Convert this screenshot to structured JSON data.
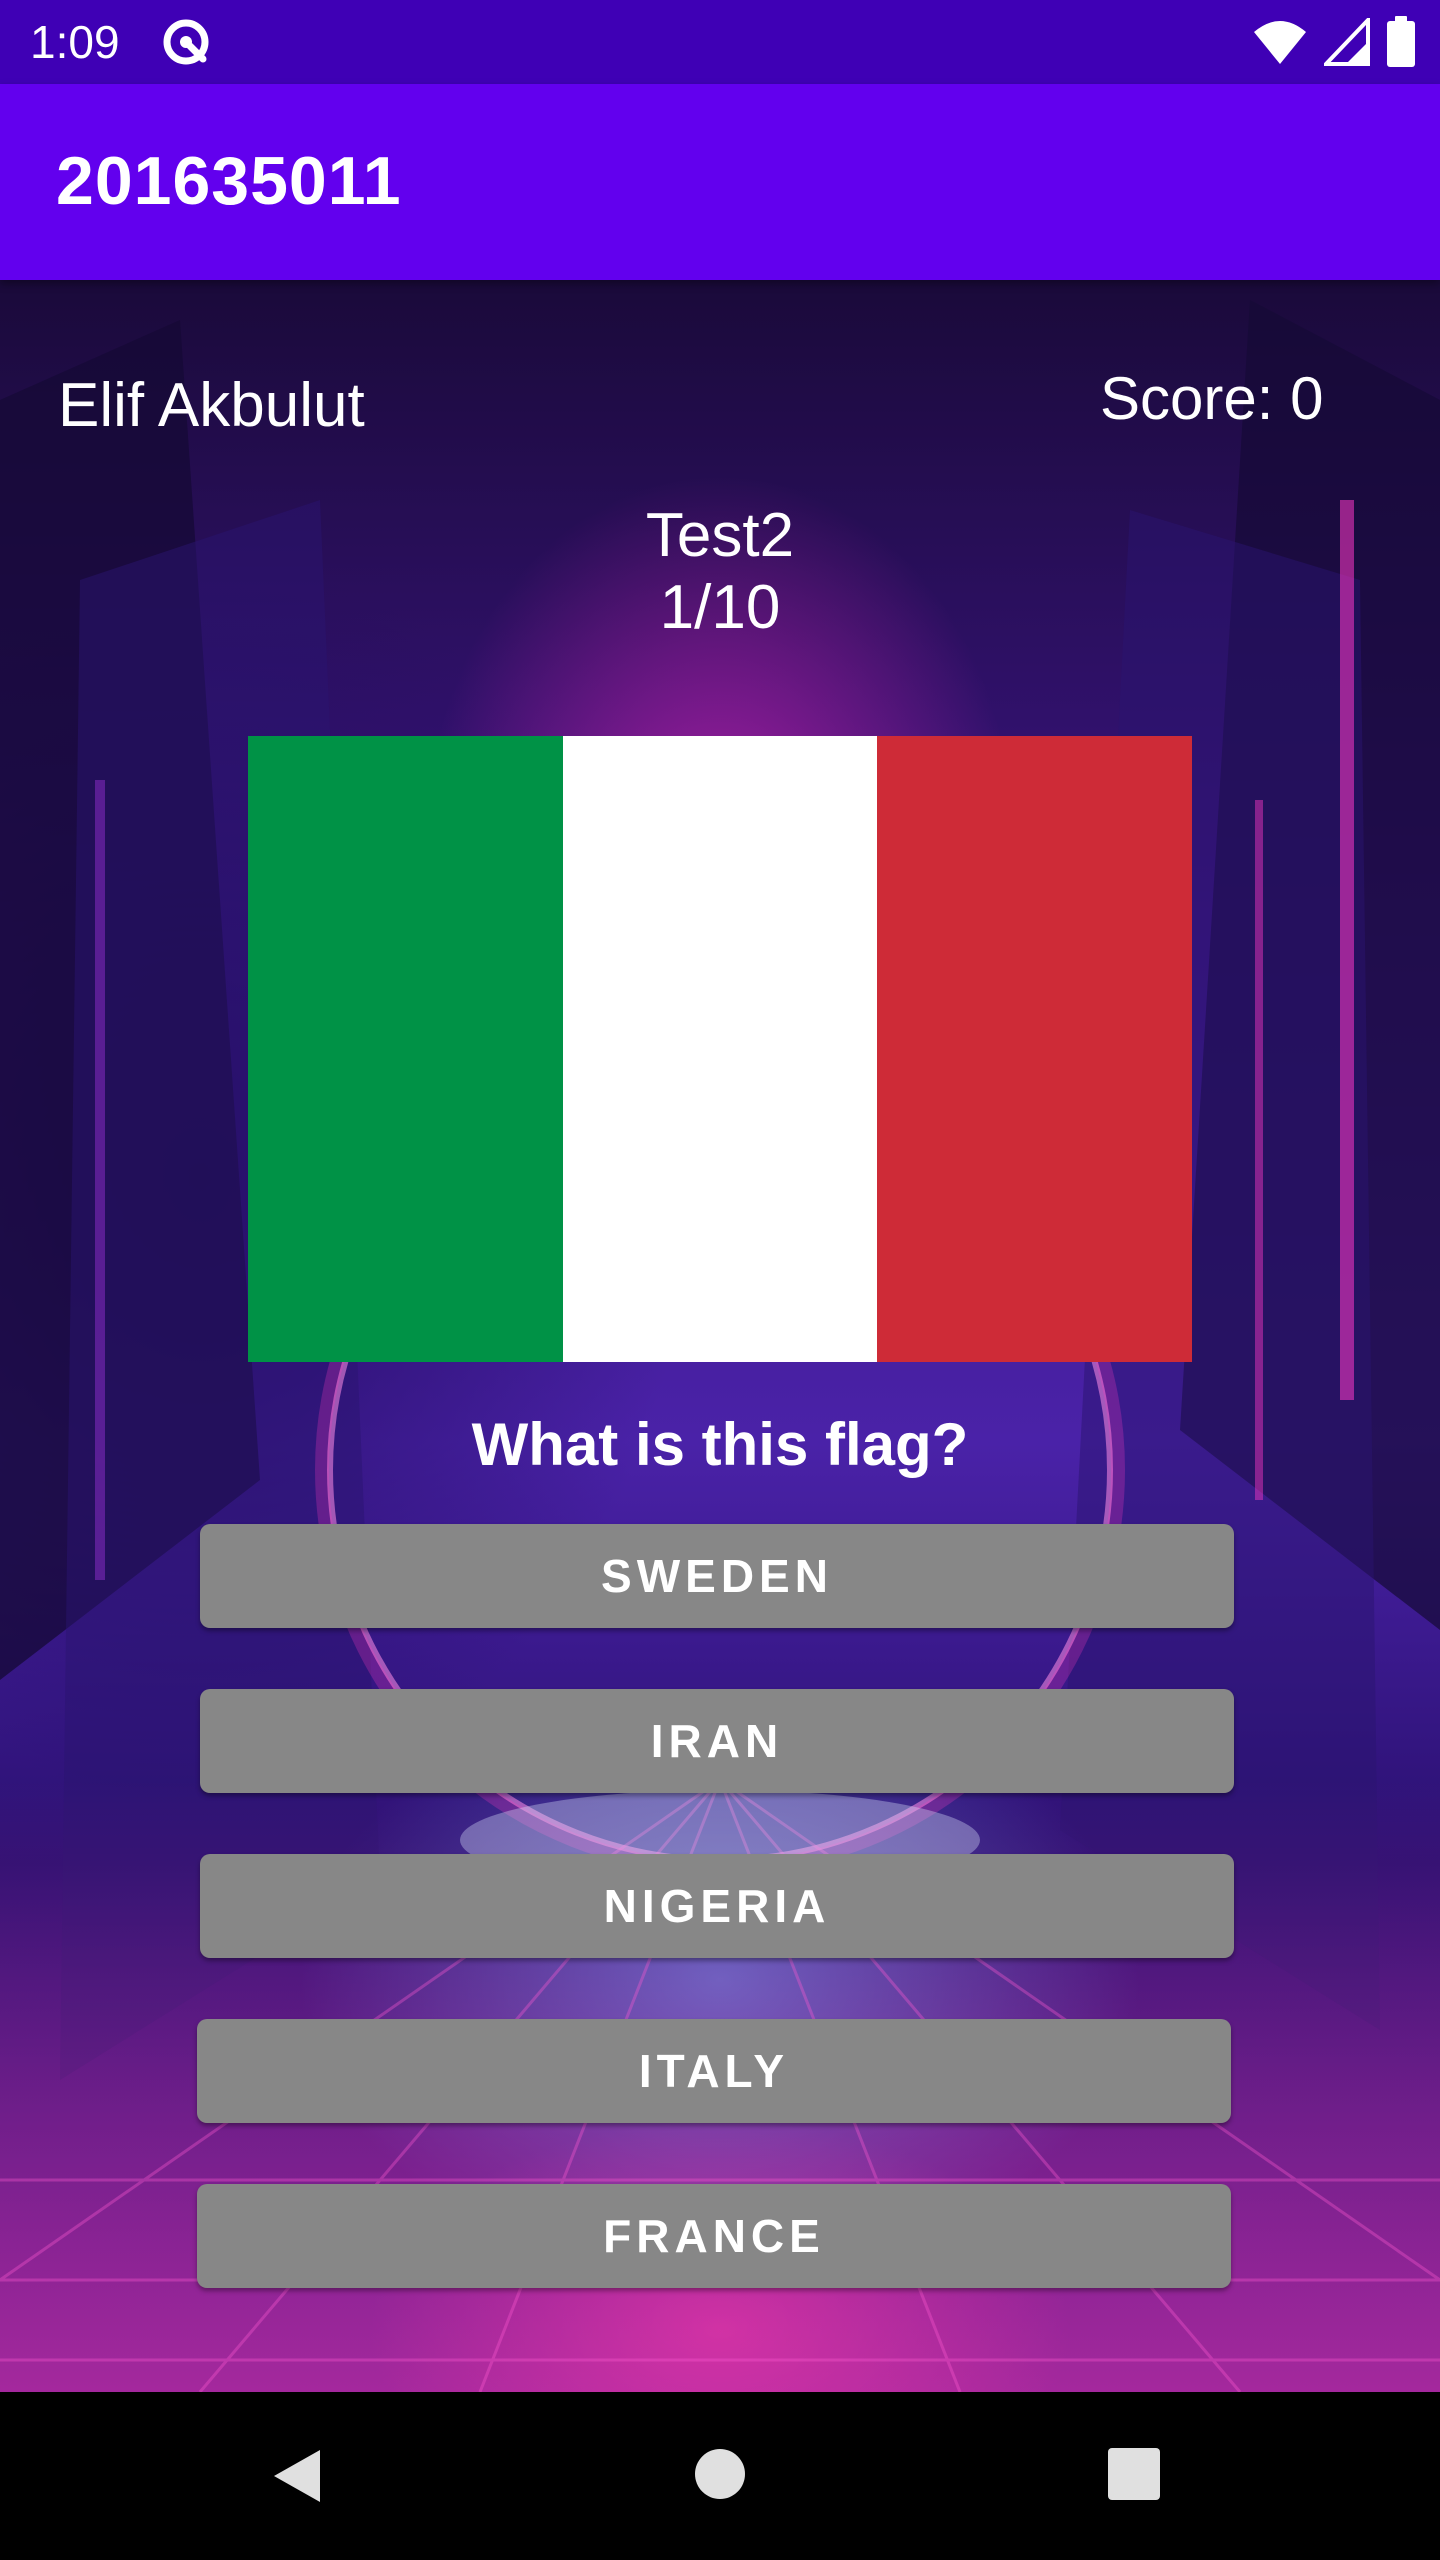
{
  "status_bar": {
    "time": "1:09",
    "icons": [
      "notification-icon",
      "wifi-icon",
      "cellular-signal-icon",
      "battery-icon"
    ]
  },
  "app_bar": {
    "title": "201635011"
  },
  "quiz": {
    "user_name": "Elif Akbulut",
    "score_label": "Score: ",
    "score_value": "0",
    "test_name": "Test2",
    "progress": "1/10",
    "question": "What is this flag?",
    "flag": {
      "colors": [
        "#009246",
        "#FFFFFF",
        "#CE2B37"
      ]
    },
    "answers": [
      {
        "label": "SWEDEN"
      },
      {
        "label": "IRAN"
      },
      {
        "label": "NIGERIA"
      },
      {
        "label": "ITALY"
      },
      {
        "label": "FRANCE"
      }
    ]
  },
  "nav_bar": {
    "icons": [
      "back-icon",
      "home-icon",
      "recents-icon"
    ]
  },
  "colors": {
    "status_bar": "#3F00B5",
    "app_bar": "#6200EE",
    "button": "#878787"
  }
}
